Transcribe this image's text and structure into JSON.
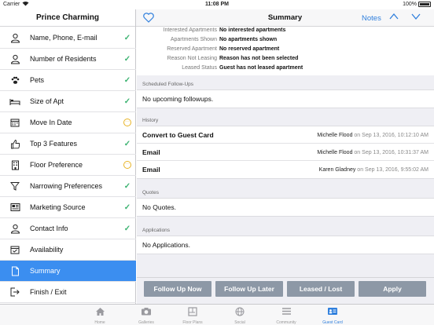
{
  "status_bar": {
    "carrier": "Carrier",
    "time": "11:08 PM",
    "battery": "100%"
  },
  "sidebar": {
    "title": "Prince Charming",
    "items": [
      {
        "label": "Name, Phone, E-mail",
        "icon": "person-icon",
        "status": "complete"
      },
      {
        "label": "Number of Residents",
        "icon": "person-icon",
        "status": "complete"
      },
      {
        "label": "Pets",
        "icon": "paw-icon",
        "status": "complete"
      },
      {
        "label": "Size of Apt",
        "icon": "bed-icon",
        "status": "complete"
      },
      {
        "label": "Move In Date",
        "icon": "calendar-icon",
        "status": "pending"
      },
      {
        "label": "Top 3 Features",
        "icon": "thumbs-up-icon",
        "status": "complete"
      },
      {
        "label": "Floor Preference",
        "icon": "building-icon",
        "status": "pending"
      },
      {
        "label": "Narrowing Preferences",
        "icon": "filter-icon",
        "status": "complete"
      },
      {
        "label": "Marketing Source",
        "icon": "newspaper-icon",
        "status": "complete"
      },
      {
        "label": "Contact Info",
        "icon": "person-icon",
        "status": "complete"
      },
      {
        "label": "Availability",
        "icon": "calendar-check-icon",
        "status": "none"
      },
      {
        "label": "Summary",
        "icon": "document-icon",
        "status": "active"
      },
      {
        "label": "Finish / Exit",
        "icon": "exit-icon",
        "status": "none"
      }
    ],
    "status_glyphs": {
      "complete": "✓",
      "pending": "···"
    },
    "colors": {
      "check": "#3cb371",
      "pending": "#e8b324",
      "active_bg": "#3b8ef0"
    }
  },
  "navbar": {
    "title": "Summary",
    "notes_label": "Notes",
    "up_glyph": "∧",
    "down_glyph": "∨",
    "accent": "#2f7fdd"
  },
  "summary_fields": [
    {
      "key": "Interested Apartments",
      "value": "No interested apartments"
    },
    {
      "key": "Apartments Shown",
      "value": "No apartments shown"
    },
    {
      "key": "Reserved Apartment",
      "value": "No reserved apartment"
    },
    {
      "key": "Reason Not Leasing",
      "value": "Reason has not been selected"
    },
    {
      "key": "Leased Status",
      "value": "Guest has not leased apartment"
    }
  ],
  "followups": {
    "header": "Scheduled Follow-Ups",
    "empty": "No upcoming followups."
  },
  "history": {
    "header": "History",
    "rows": [
      {
        "event": "Convert to Guest Card",
        "who": "Michelle Flood",
        "date": " on Sep 13, 2016, 10:12:10 AM"
      },
      {
        "event": "Email",
        "who": "Michelle Flood",
        "date": " on Sep 13, 2016, 10:31:37 AM"
      },
      {
        "event": "Email",
        "who": "Karen Gladney",
        "date": " on Sep 13, 2016, 9:55:02 AM"
      }
    ]
  },
  "quotes": {
    "header": "Quotes",
    "empty": "No Quotes."
  },
  "applications": {
    "header": "Applications",
    "empty": "No Applications."
  },
  "actions": {
    "follow_up_now": "Follow Up Now",
    "follow_up_later": "Follow Up Later",
    "leased_lost": "Leased / Lost",
    "apply": "Apply",
    "button_color": "#8d98a6"
  },
  "tabbar": {
    "tabs": [
      {
        "label": "Home",
        "icon": "home-icon"
      },
      {
        "label": "Galleries",
        "icon": "camera-icon"
      },
      {
        "label": "Floor Plans",
        "icon": "floor-plan-icon"
      },
      {
        "label": "Social",
        "icon": "globe-icon"
      },
      {
        "label": "Community",
        "icon": "list-icon"
      },
      {
        "label": "Guest Card",
        "icon": "guest-card-icon",
        "active": true
      }
    ]
  }
}
